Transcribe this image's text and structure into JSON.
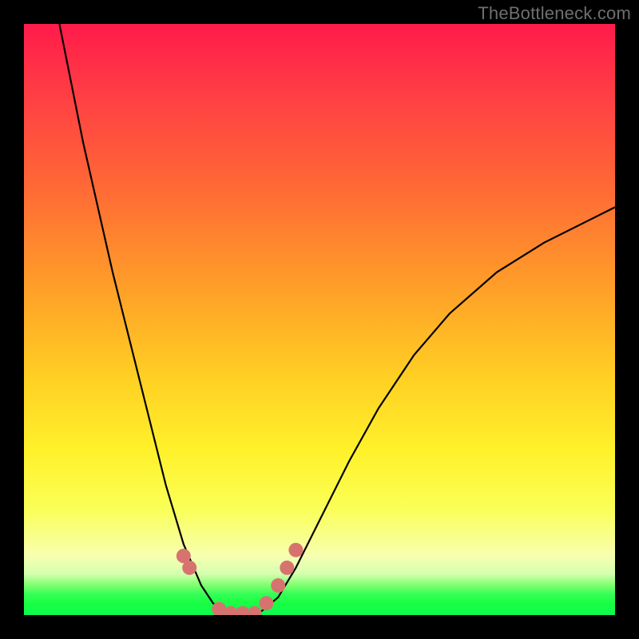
{
  "watermark": "TheBottleneck.com",
  "chart_data": {
    "type": "line",
    "title": "",
    "xlabel": "",
    "ylabel": "",
    "xlim": [
      0,
      100
    ],
    "ylim": [
      0,
      100
    ],
    "grid": false,
    "legend": false,
    "series": [
      {
        "name": "bottleneck-curve",
        "x": [
          6,
          10,
          15,
          20,
          24,
          27,
          30,
          32,
          34,
          36,
          38,
          40,
          43,
          46,
          50,
          55,
          60,
          66,
          72,
          80,
          88,
          96,
          100
        ],
        "values": [
          100,
          80,
          58,
          38,
          22,
          12,
          5,
          2,
          0.5,
          0,
          0,
          0.5,
          3,
          8,
          16,
          26,
          35,
          44,
          51,
          58,
          63,
          67,
          69
        ]
      }
    ],
    "markers": {
      "name": "highlight-dots",
      "color": "#d7736f",
      "points": [
        {
          "x": 27,
          "y": 10
        },
        {
          "x": 28,
          "y": 8
        },
        {
          "x": 33,
          "y": 1
        },
        {
          "x": 35,
          "y": 0.3
        },
        {
          "x": 37,
          "y": 0.3
        },
        {
          "x": 39,
          "y": 0.3
        },
        {
          "x": 41,
          "y": 2
        },
        {
          "x": 43,
          "y": 5
        },
        {
          "x": 44.5,
          "y": 8
        },
        {
          "x": 46,
          "y": 11
        }
      ]
    }
  }
}
